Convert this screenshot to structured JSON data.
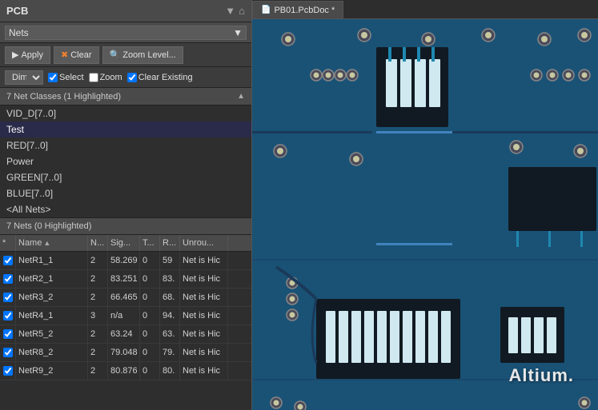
{
  "panel": {
    "title": "PCB",
    "header_icons": [
      "▼",
      "⌂"
    ],
    "nets_dropdown": "Nets"
  },
  "toolbar": {
    "apply_label": "Apply",
    "clear_label": "Clear",
    "zoom_level_label": "Zoom Level..."
  },
  "options": {
    "dim_label": "Dim",
    "select_label": "Select",
    "zoom_label": "Zoom",
    "clear_existing_label": "Clear Existing"
  },
  "net_classes_section": {
    "title": "7 Net Classes (1 Highlighted)"
  },
  "net_classes": [
    {
      "name": "VID_D[7..0]",
      "selected": false
    },
    {
      "name": "Test",
      "selected": true
    },
    {
      "name": "RED[7..0]",
      "selected": false
    },
    {
      "name": "Power",
      "selected": false
    },
    {
      "name": "GREEN[7..0]",
      "selected": false
    },
    {
      "name": "BLUE[7..0]",
      "selected": false
    },
    {
      "name": "<All Nets>",
      "selected": false
    }
  ],
  "nets_section": {
    "title": "7 Nets (0 Highlighted)"
  },
  "table": {
    "headers": [
      "*",
      "Name",
      "N...",
      "Sig...",
      "T...",
      "R...",
      "Unrou..."
    ],
    "rows": [
      {
        "checked": true,
        "name": "NetR1_1",
        "n": "2",
        "sig": "58.269",
        "t": "0",
        "r": "59",
        "unrou": "Net is Hic"
      },
      {
        "checked": true,
        "name": "NetR2_1",
        "n": "2",
        "sig": "83.251",
        "t": "0",
        "r": "83.",
        "unrou": "Net is Hic"
      },
      {
        "checked": true,
        "name": "NetR3_2",
        "n": "2",
        "sig": "66.465",
        "t": "0",
        "r": "68.",
        "unrou": "Net is Hic"
      },
      {
        "checked": true,
        "name": "NetR4_1",
        "n": "3",
        "sig": "n/a",
        "t": "0",
        "r": "94.",
        "unrou": "Net is Hic"
      },
      {
        "checked": true,
        "name": "NetR5_2",
        "n": "2",
        "sig": "63.24",
        "t": "0",
        "r": "63.",
        "unrou": "Net is Hic"
      },
      {
        "checked": true,
        "name": "NetR8_2",
        "n": "2",
        "sig": "79.048",
        "t": "0",
        "r": "79.",
        "unrou": "Net is Hic"
      },
      {
        "checked": true,
        "name": "NetR9_2",
        "n": "2",
        "sig": "80.876",
        "t": "0",
        "r": "80.",
        "unrou": "Net is Hic"
      }
    ]
  },
  "tab": {
    "label": "PB01.PcbDoc *",
    "icon": "📄"
  },
  "altium": {
    "watermark": "Altium."
  }
}
